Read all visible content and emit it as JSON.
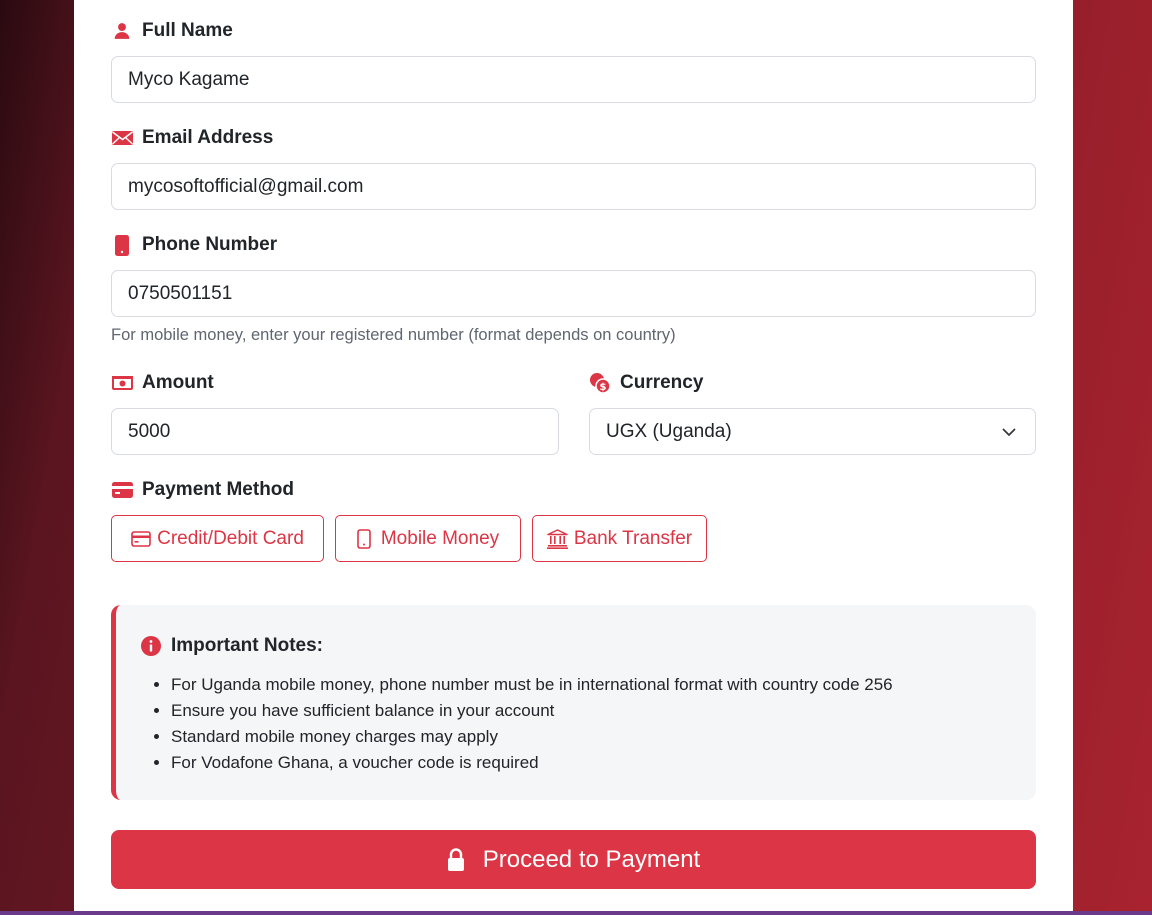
{
  "form": {
    "full_name": {
      "label": "Full Name",
      "value": "Myco Kagame",
      "icon": "user-icon"
    },
    "email": {
      "label": "Email Address",
      "value": "mycosoftofficial@gmail.com",
      "icon": "envelope-icon"
    },
    "phone": {
      "label": "Phone Number",
      "value": "0750501151",
      "icon": "phone-icon",
      "help": "For mobile money, enter your registered number (format depends on country)"
    },
    "amount": {
      "label": "Amount",
      "value": "5000",
      "icon": "cash-icon"
    },
    "currency": {
      "label": "Currency",
      "selected": "UGX (Uganda)",
      "icon": "currency-exchange-icon"
    },
    "payment_method": {
      "label": "Payment Method",
      "icon": "credit-card-icon",
      "options": [
        "Credit/Debit Card",
        "Mobile Money",
        "Bank Transfer"
      ]
    }
  },
  "notes": {
    "title": "Important Notes:",
    "items": [
      "For Uganda mobile money, phone number must be in international format with country code 256",
      "Ensure you have sufficient balance in your account",
      "Standard mobile money charges may apply",
      "For Vodafone Ghana, a voucher code is required"
    ]
  },
  "submit": {
    "label": "Proceed to Payment",
    "icon": "lock-icon"
  },
  "colors": {
    "accent": "#dc3545",
    "notes_bg": "#f5f6f8",
    "text": "#212529"
  }
}
